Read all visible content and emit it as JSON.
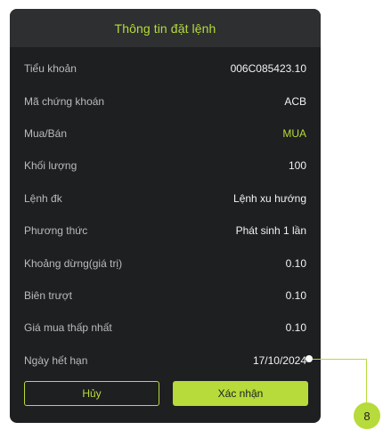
{
  "dialog": {
    "title": "Thông tin đặt lệnh",
    "rows": [
      {
        "label": "Tiểu khoản",
        "value": "006C085423.10"
      },
      {
        "label": "Mã chứng khoán",
        "value": "ACB"
      },
      {
        "label": "Mua/Bán",
        "value": "MUA"
      },
      {
        "label": "Khối lượng",
        "value": "100"
      },
      {
        "label": "Lệnh đk",
        "value": "Lệnh xu hướng"
      },
      {
        "label": "Phương thức",
        "value": "Phát sinh 1 lần"
      },
      {
        "label": "Khoảng dừng(giá trị)",
        "value": "0.10"
      },
      {
        "label": "Biên trượt",
        "value": "0.10"
      },
      {
        "label": "Giá mua thấp nhất",
        "value": "0.10"
      },
      {
        "label": "Ngày hết hạn",
        "value": "17/10/2024"
      }
    ],
    "cancel_label": "Hủy",
    "confirm_label": "Xác nhận"
  },
  "callout": {
    "number": "8"
  },
  "colors": {
    "accent": "#b6db3a",
    "background": "#1e1f21",
    "header": "#2d2f31"
  }
}
